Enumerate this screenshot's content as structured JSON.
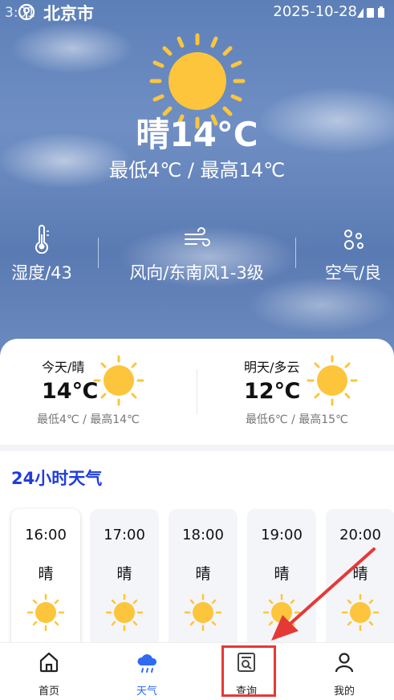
{
  "status": {
    "time": "3:01",
    "city": "北京市",
    "date": "2025-10-28"
  },
  "current": {
    "cond_temp": "晴14°C",
    "minmax": "最低4℃ / 最高14℃"
  },
  "metrics": [
    {
      "icon": "thermometer-icon",
      "label": "湿度/43"
    },
    {
      "icon": "wind-icon",
      "label": "风向/东南风1-3级"
    },
    {
      "icon": "air-icon",
      "label": "空气/良"
    }
  ],
  "forecast": {
    "today": {
      "title": "今天/晴",
      "temp": "14℃",
      "range": "最低4℃ / 最高14℃"
    },
    "tomorrow": {
      "title": "明天/多云",
      "temp": "12℃",
      "range": "最低6℃ / 最高15℃"
    }
  },
  "hourly": {
    "title": "24小时天气",
    "items": [
      {
        "time": "16:00",
        "cond": "晴"
      },
      {
        "time": "17:00",
        "cond": "晴"
      },
      {
        "time": "18:00",
        "cond": "晴"
      },
      {
        "time": "19:00",
        "cond": "晴"
      },
      {
        "time": "20:00",
        "cond": "晴"
      }
    ]
  },
  "tabs": [
    {
      "label": "首页",
      "icon": "home-icon"
    },
    {
      "label": "天气",
      "icon": "weather-cloud-icon",
      "active": true
    },
    {
      "label": "查询",
      "icon": "query-icon"
    },
    {
      "label": "我的",
      "icon": "profile-icon"
    }
  ],
  "colors": {
    "accent": "#2f6bf0",
    "sun": "#fcc53c",
    "highlight": "#e53935",
    "title_blue": "#1f3ddc"
  }
}
